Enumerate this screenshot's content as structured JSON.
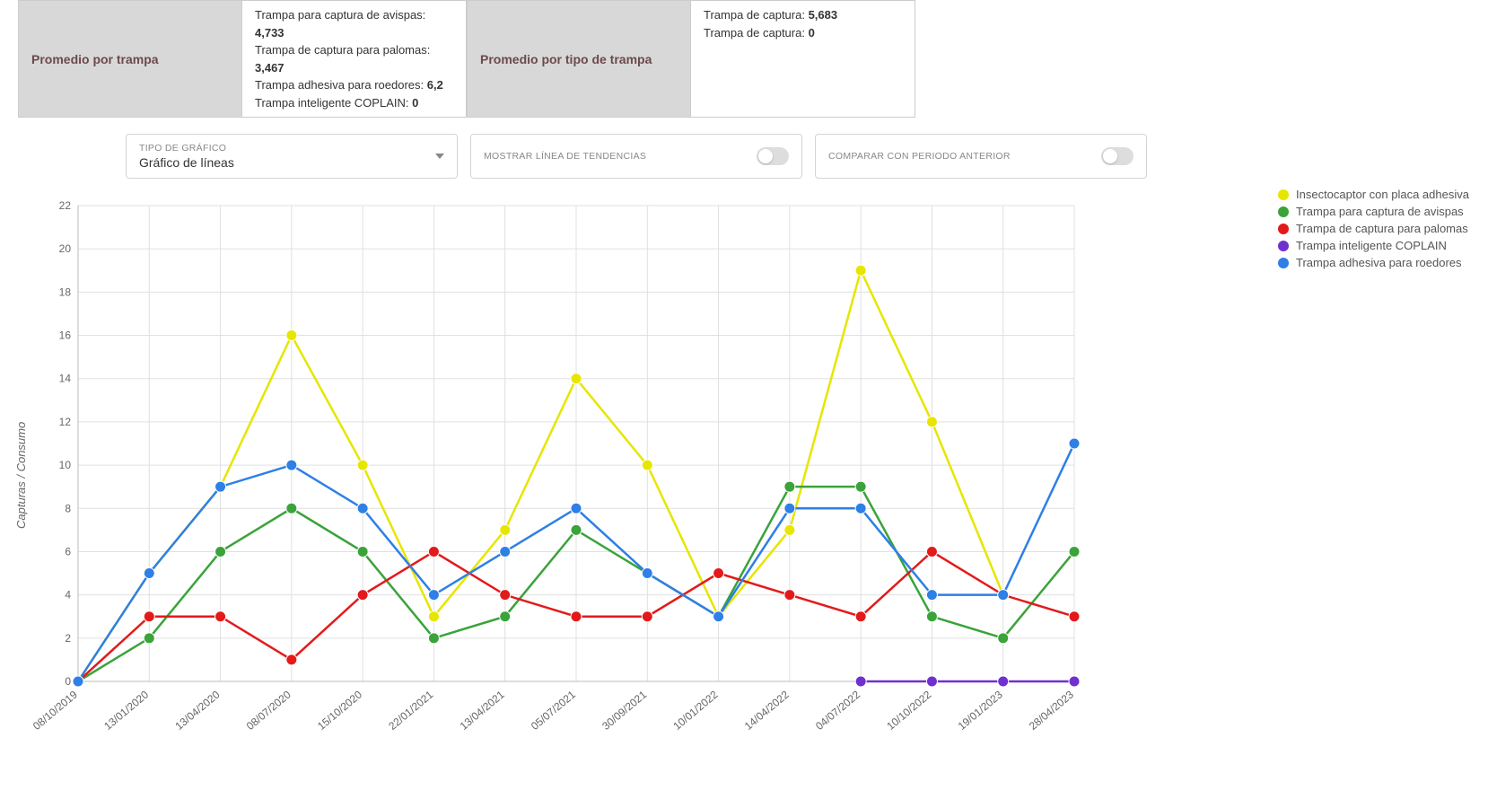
{
  "stats": {
    "left_header": "Promedio por trampa",
    "left_lines": [
      {
        "label": "Trampa para captura de avispas",
        "value": "4,733"
      },
      {
        "label": "Trampa de captura para palomas",
        "value": "3,467"
      },
      {
        "label": "Trampa adhesiva para roedores",
        "value": "6,2"
      },
      {
        "label": "Trampa inteligente COPLAIN",
        "value": "0"
      }
    ],
    "right_header": "Promedio por tipo de trampa",
    "right_lines": [
      {
        "label": "Trampa de captura",
        "value": "5,683"
      },
      {
        "label": "Trampa de captura",
        "value": "0"
      }
    ]
  },
  "controls": {
    "chart_type_label": "TIPO DE GRÁFICO",
    "chart_type_value": "Gráfico de líneas",
    "trend_label": "MOSTRAR LÍNEA DE TENDENCIAS",
    "compare_label": "COMPARAR CON PERIODO ANTERIOR"
  },
  "chart_data": {
    "type": "line",
    "ylabel": "Capturas / Consumo",
    "xlabel": "",
    "ylim": [
      0,
      22
    ],
    "categories": [
      "08/10/2019",
      "13/01/2020",
      "13/04/2020",
      "08/07/2020",
      "15/10/2020",
      "22/01/2021",
      "13/04/2021",
      "05/07/2021",
      "30/09/2021",
      "10/01/2022",
      "14/04/2022",
      "04/07/2022",
      "10/10/2022",
      "19/01/2023",
      "28/04/2023"
    ],
    "colors": {
      "insectocaptor": "#e6e600",
      "avispas": "#3aa33a",
      "palomas": "#e31a1a",
      "coplain": "#7030d0",
      "roedores": "#2e7fe6"
    },
    "series": [
      {
        "key": "insectocaptor",
        "name": "Insectocaptor con placa adhesiva",
        "values": [
          0,
          5,
          9,
          16,
          10,
          3,
          7,
          14,
          10,
          3,
          7,
          19,
          12,
          4,
          null
        ]
      },
      {
        "key": "avispas",
        "name": "Trampa para captura de avispas",
        "values": [
          0,
          2,
          6,
          8,
          6,
          2,
          3,
          7,
          5,
          3,
          9,
          9,
          3,
          2,
          6
        ]
      },
      {
        "key": "palomas",
        "name": "Trampa de captura para palomas",
        "values": [
          0,
          3,
          3,
          1,
          4,
          6,
          4,
          3,
          3,
          5,
          4,
          3,
          6,
          4,
          3
        ]
      },
      {
        "key": "coplain",
        "name": "Trampa inteligente COPLAIN",
        "values": [
          null,
          null,
          null,
          null,
          null,
          null,
          null,
          null,
          null,
          null,
          null,
          0,
          0,
          0,
          0
        ]
      },
      {
        "key": "roedores",
        "name": "Trampa adhesiva para roedores",
        "values": [
          0,
          5,
          9,
          10,
          8,
          4,
          6,
          8,
          5,
          3,
          8,
          8,
          4,
          4,
          11
        ]
      }
    ]
  }
}
